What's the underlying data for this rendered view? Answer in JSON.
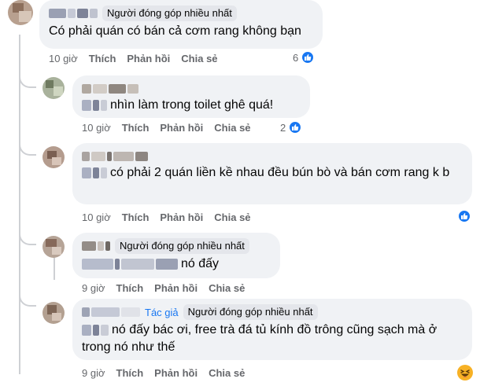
{
  "badges": {
    "top_contributor": "Người đóng góp nhiều nhất",
    "author": "Tác giả"
  },
  "actions": {
    "like": "Thích",
    "reply": "Phản hồi",
    "share": "Chia sẻ"
  },
  "comments": [
    {
      "text": "Có phải quán có bán cả cơm rang không bạn",
      "time": "10 giờ",
      "reaction_count": "6",
      "reaction": "like"
    },
    {
      "text": "nhìn làm trong toilet ghê quá!",
      "time": "10 giờ",
      "reaction_count": "2",
      "reaction": "like"
    },
    {
      "text": "có phải 2 quán liền kề nhau đều bún bò và bán cơm rang k b",
      "time": "10 giờ",
      "reaction_count": "",
      "reaction": "like"
    },
    {
      "text": "nó đấy",
      "time": "9 giờ",
      "reaction_count": "",
      "reaction": ""
    },
    {
      "text": "nó đấy bác ơi, free trà đá tủ kính đồ trông cũng sạch mà ở trong nó như thế",
      "time": "9 giờ",
      "reaction_count": "",
      "reaction": "haha"
    }
  ],
  "colors": {
    "bubble": "#f0f2f5",
    "badge": "#e4e6eb",
    "meta": "#65676b",
    "link": "#1877f2",
    "thread": "#ced0d4"
  },
  "icons": {
    "like": "thumbs-up-icon",
    "haha": "laughing-face-icon"
  }
}
